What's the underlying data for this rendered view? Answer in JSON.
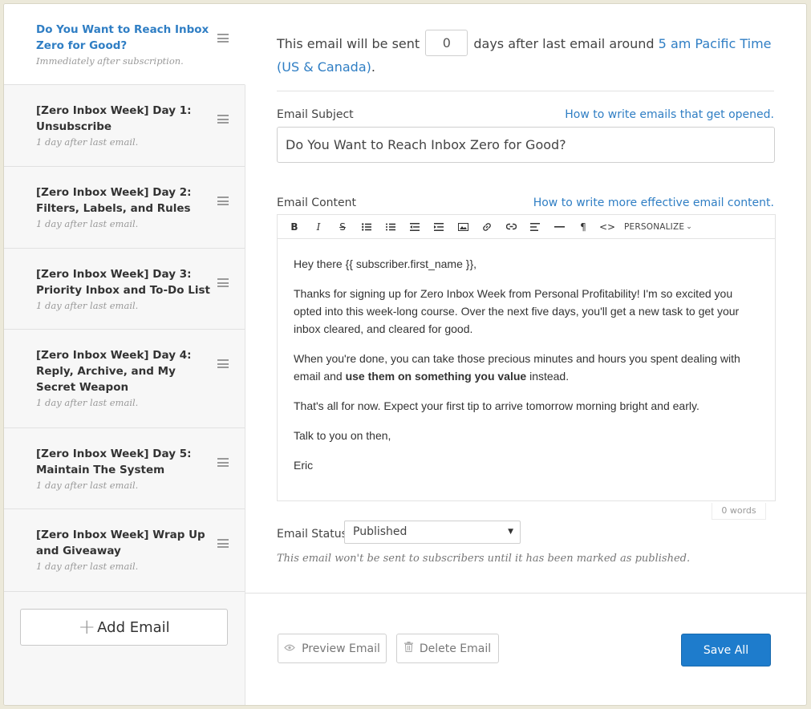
{
  "sidebar": {
    "items": [
      {
        "title": "Do You Want to Reach Inbox Zero for Good?",
        "subtitle": "Immediately after subscription."
      },
      {
        "title": "[Zero Inbox Week] Day 1: Unsubscribe",
        "subtitle": "1 day after last email."
      },
      {
        "title": "[Zero Inbox Week] Day 2: Filters, Labels, and Rules",
        "subtitle": "1 day after last email."
      },
      {
        "title": "[Zero Inbox Week] Day 3: Priority Inbox and To-Do List",
        "subtitle": "1 day after last email."
      },
      {
        "title": "[Zero Inbox Week] Day 4: Reply, Archive, and My Secret Weapon",
        "subtitle": "1 day after last email."
      },
      {
        "title": "[Zero Inbox Week] Day 5: Maintain The System",
        "subtitle": "1 day after last email."
      },
      {
        "title": "[Zero Inbox Week] Wrap Up and Giveaway",
        "subtitle": "1 day after last email."
      }
    ],
    "add_label": "Add Email"
  },
  "schedule": {
    "prefix": "This email will be sent",
    "days": "0",
    "middle": "days after last email around",
    "time_link": "5 am Pacific Time (US & Canada)",
    "suffix": "."
  },
  "subject": {
    "label": "Email Subject",
    "help_link": "How to write emails that get opened.",
    "value": "Do You Want to Reach Inbox Zero for Good?"
  },
  "content": {
    "label": "Email Content",
    "help_link": "How to write more effective email content.",
    "toolbar": {
      "personalize": "PERSONALIZE"
    },
    "greeting": "Hey there {{ subscriber.first_name }},",
    "para1": "Thanks for signing up for Zero Inbox Week from Personal Profitability! I'm so excited you opted into this week-long course. Over the next five days, you'll get a new task to get your inbox cleared, and cleared for good.",
    "para2_start": "When you're done, you can take those precious minutes and hours you spent dealing with email and ",
    "para2_bold": "use them on something you value",
    "para2_end": " instead.",
    "para3": "That's all for now. Expect your first tip to arrive tomorrow morning bright and early.",
    "para4": "Talk to you on then,",
    "signature": "Eric",
    "word_count": "0 words"
  },
  "status": {
    "label": "Email Status",
    "selected": "Published",
    "note": "This email won't be sent to subscribers until it has been marked as published."
  },
  "actions": {
    "preview": "Preview Email",
    "delete": "Delete Email",
    "save": "Save All"
  },
  "colors": {
    "accent": "#2f7ec4",
    "save": "#1e7ccc"
  }
}
